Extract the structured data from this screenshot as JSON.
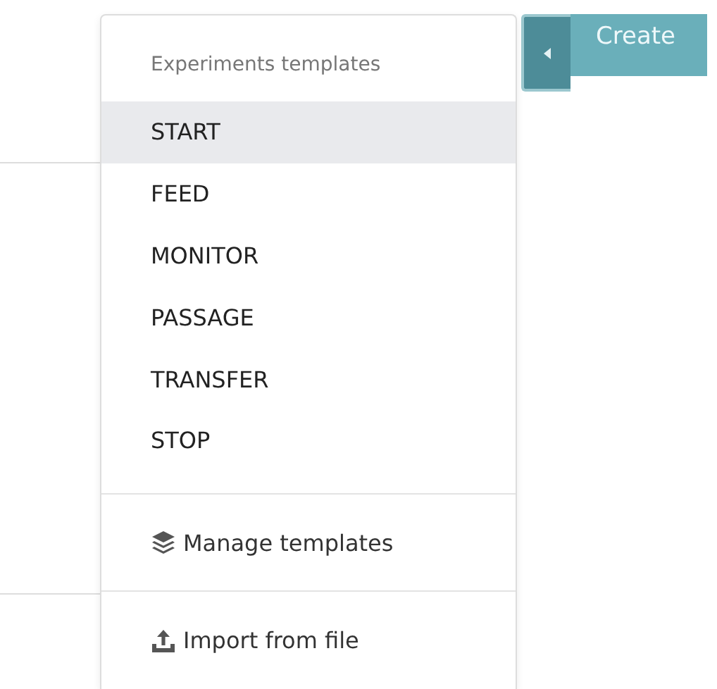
{
  "menu": {
    "header": "Experiments templates",
    "items": [
      {
        "label": "START",
        "selected": true
      },
      {
        "label": "FEED",
        "selected": false
      },
      {
        "label": "MONITOR",
        "selected": false
      },
      {
        "label": "PASSAGE",
        "selected": false
      },
      {
        "label": "TRANSFER",
        "selected": false
      },
      {
        "label": "STOP",
        "selected": false
      }
    ],
    "actions": [
      {
        "kind": "layers",
        "label": "Manage templates"
      },
      {
        "kind": "upload",
        "label": "Import from file"
      }
    ]
  },
  "create_button": {
    "label": "Create"
  }
}
